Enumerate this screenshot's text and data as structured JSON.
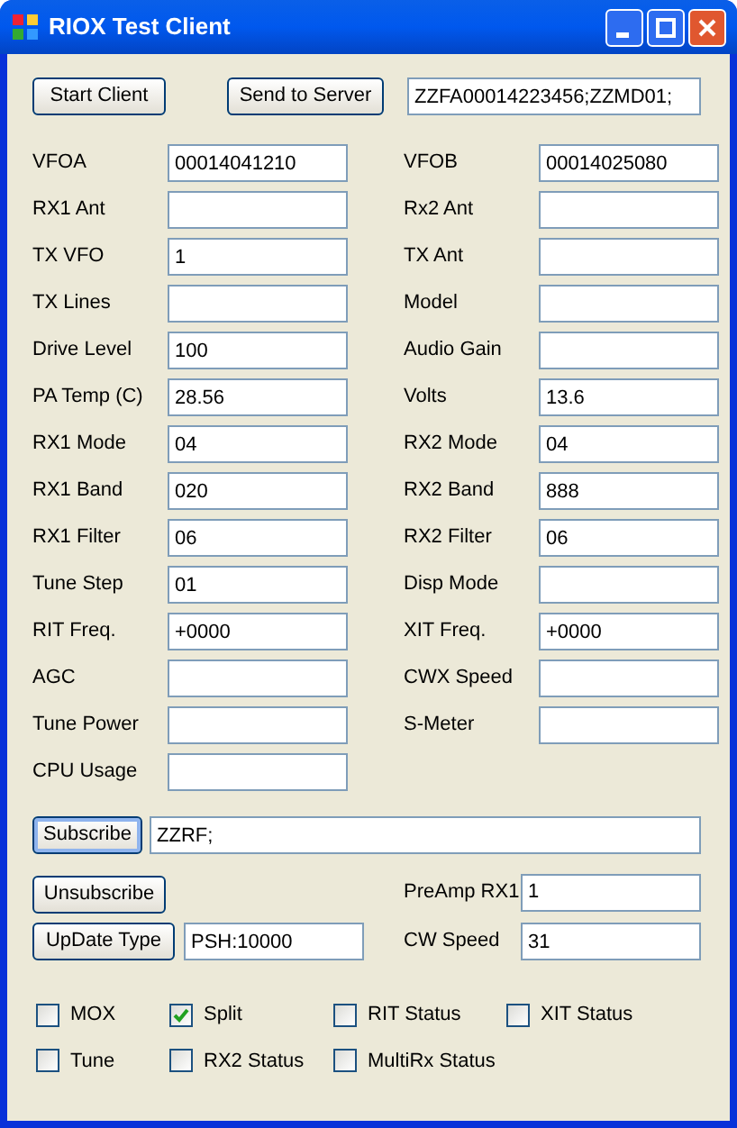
{
  "window": {
    "title": "RIOX Test Client"
  },
  "toolbar": {
    "start_button": "Start Client",
    "send_button": "Send to Server",
    "command_field": "ZZFA00014223456;ZZMD01;"
  },
  "rows": [
    {
      "left": {
        "label": "VFOA",
        "value": "00014041210"
      },
      "right": {
        "label": "VFOB",
        "value": "00014025080"
      }
    },
    {
      "left": {
        "label": "RX1 Ant"
      },
      "right": {
        "label": "Rx2 Ant"
      }
    },
    {
      "left": {
        "label": "TX VFO",
        "value": "1"
      },
      "right": {
        "label": "TX Ant"
      }
    },
    {
      "left": {
        "label": "TX Lines"
      },
      "right": {
        "label": "Model"
      }
    },
    {
      "left": {
        "label": "Drive Level",
        "value": "100"
      },
      "right": {
        "label": "Audio Gain"
      }
    },
    {
      "left": {
        "label": "PA Temp (C)",
        "value": "28.56"
      },
      "right": {
        "label": "Volts",
        "value": "13.6"
      }
    },
    {
      "left": {
        "label": "RX1 Mode",
        "value": "04"
      },
      "right": {
        "label": "RX2 Mode",
        "value": "04"
      }
    },
    {
      "left": {
        "label": "RX1 Band",
        "value": "020"
      },
      "right": {
        "label": "RX2 Band",
        "value": "888"
      }
    },
    {
      "left": {
        "label": "RX1 Filter",
        "value": "06"
      },
      "right": {
        "label": "RX2 Filter",
        "value": "06"
      }
    },
    {
      "left": {
        "label": "Tune Step",
        "value": "01"
      },
      "right": {
        "label": "Disp Mode"
      }
    },
    {
      "left": {
        "label": "RIT Freq.",
        "value": "+0000"
      },
      "right": {
        "label": "XIT Freq.",
        "value": "+0000"
      }
    },
    {
      "left": {
        "label": "AGC"
      },
      "right": {
        "label": "CWX Speed"
      }
    },
    {
      "left": {
        "label": "Tune Power"
      },
      "right": {
        "label": "S-Meter"
      }
    },
    {
      "left": {
        "label": "CPU Usage"
      }
    }
  ],
  "subscribe": {
    "button": "Subscribe",
    "field": "ZZRF;"
  },
  "unsubscribe": {
    "button": "Unsubscribe",
    "label": "PreAmp RX1",
    "value": "1"
  },
  "update": {
    "button": "UpDate Type",
    "field": "PSH:10000",
    "label": "CW Speed",
    "value": "31"
  },
  "checkbox_rows": [
    [
      {
        "label": "MOX",
        "checked": false
      },
      {
        "label": "Split",
        "checked": true
      },
      {
        "label": "RIT Status",
        "checked": false
      },
      {
        "label": "XIT Status",
        "checked": false
      }
    ],
    [
      {
        "label": "Tune",
        "checked": false
      },
      {
        "label": "RX2 Status",
        "checked": false
      },
      {
        "label": "MultiRx Status",
        "checked": false
      }
    ]
  ]
}
